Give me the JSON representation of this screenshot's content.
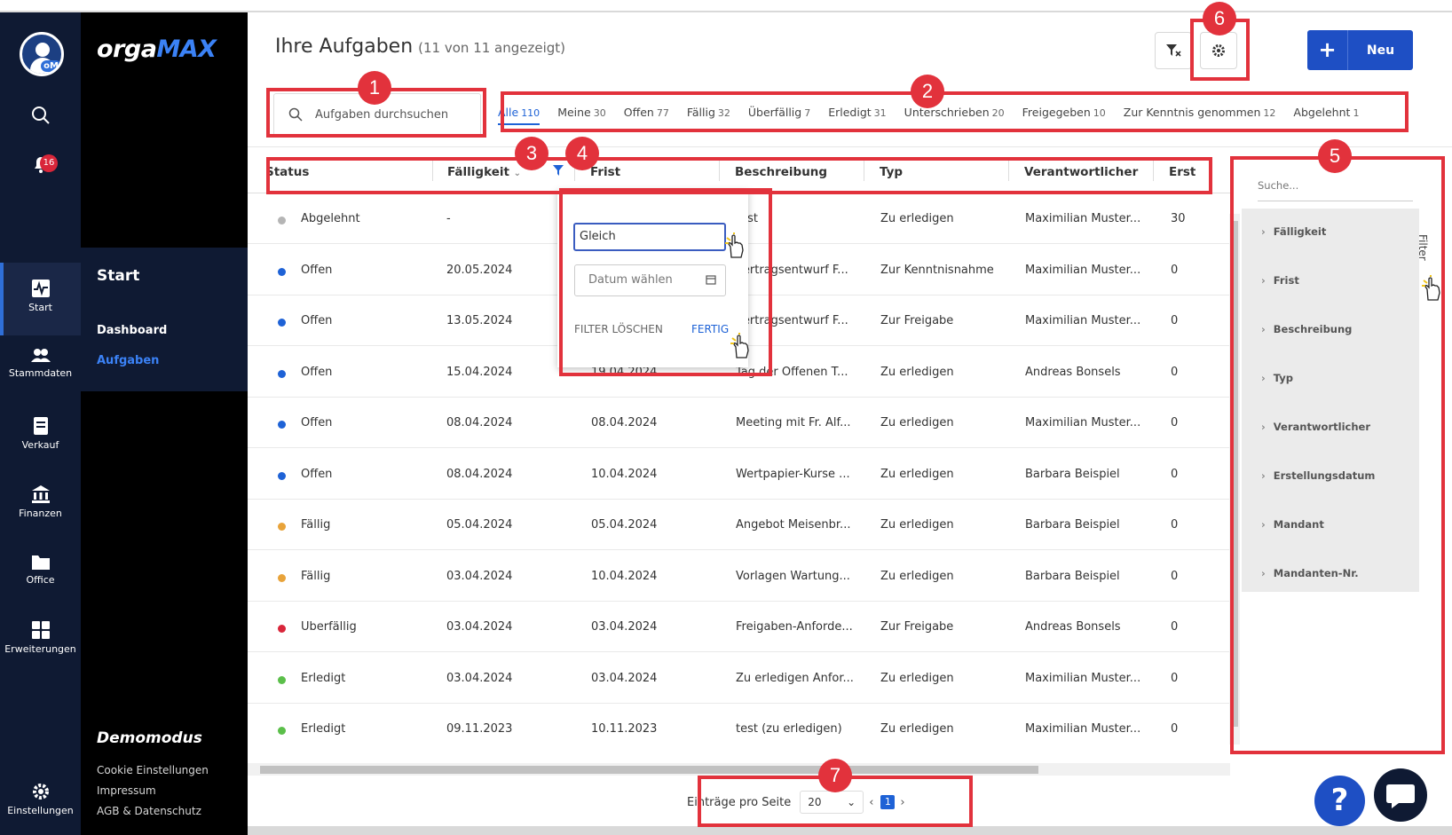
{
  "app": {
    "logo_a": "orga",
    "logo_b": "MAX"
  },
  "rail": {
    "avatar_badge": "oM",
    "notifications_count": "16",
    "items": [
      {
        "label": "Start",
        "icon": "pulse-icon"
      },
      {
        "label": "Stammdaten",
        "icon": "people-icon"
      },
      {
        "label": "Verkauf",
        "icon": "invoice-icon"
      },
      {
        "label": "Finanzen",
        "icon": "bank-icon"
      },
      {
        "label": "Office",
        "icon": "folder-icon"
      },
      {
        "label": "Erweiterungen",
        "icon": "grid-icon"
      },
      {
        "label": "Einstellungen",
        "icon": "gear-icon"
      }
    ]
  },
  "sidebar": {
    "section_title": "Start",
    "items": [
      "Dashboard",
      "Aufgaben"
    ],
    "mode": "Demomodus",
    "links": [
      "Cookie Einstellungen",
      "Impressum",
      "AGB & Datenschutz"
    ]
  },
  "header": {
    "title": "Ihre Aufgaben",
    "subtitle": "(11 von 11 angezeigt)",
    "new_label": "Neu"
  },
  "search": {
    "placeholder": "Aufgaben durchsuchen"
  },
  "tabs": [
    {
      "label": "Alle",
      "count": "110"
    },
    {
      "label": "Meine",
      "count": "30"
    },
    {
      "label": "Offen",
      "count": "77"
    },
    {
      "label": "Fällig",
      "count": "32"
    },
    {
      "label": "Überfällig",
      "count": "7"
    },
    {
      "label": "Erledigt",
      "count": "31"
    },
    {
      "label": "Unterschrieben",
      "count": "20"
    },
    {
      "label": "Freigegeben",
      "count": "10"
    },
    {
      "label": "Zur Kenntnis genommen",
      "count": "12"
    },
    {
      "label": "Abgelehnt",
      "count": "1"
    }
  ],
  "columns": [
    "Status",
    "Fälligkeit",
    "Frist",
    "Beschreibung",
    "Typ",
    "Verantwortlicher",
    "Erst"
  ],
  "status_colors": {
    "Abgelehnt": "#b5b5b5",
    "Offen": "#1e62d6",
    "Fällig": "#e8a33a",
    "Überfällig": "#d9263a",
    "Erledigt": "#5bbf4a"
  },
  "rows": [
    {
      "status": "Abgelehnt",
      "faellig": "-",
      "frist": "",
      "beschreibung": "test",
      "typ": "Zu erledigen",
      "verantwortlich": "Maximilian Muster...",
      "erst": "30"
    },
    {
      "status": "Offen",
      "faellig": "20.05.2024",
      "frist": "",
      "beschreibung": "Vertragsentwurf F...",
      "typ": "Zur Kenntnisnahme",
      "verantwortlich": "Maximilian Muster...",
      "erst": "0"
    },
    {
      "status": "Offen",
      "faellig": "13.05.2024",
      "frist": "",
      "beschreibung": "Vertragsentwurf F...",
      "typ": "Zur Freigabe",
      "verantwortlich": "Maximilian Muster...",
      "erst": "0"
    },
    {
      "status": "Offen",
      "faellig": "15.04.2024",
      "frist": "19.04.2024",
      "beschreibung": "Tag der Offenen T...",
      "typ": "Zu erledigen",
      "verantwortlich": "Andreas Bonsels",
      "erst": "0"
    },
    {
      "status": "Offen",
      "faellig": "08.04.2024",
      "frist": "08.04.2024",
      "beschreibung": "Meeting mit Fr. Alf...",
      "typ": "Zu erledigen",
      "verantwortlich": "Maximilian Muster...",
      "erst": "0"
    },
    {
      "status": "Offen",
      "faellig": "08.04.2024",
      "frist": "10.04.2024",
      "beschreibung": "Wertpapier-Kurse ...",
      "typ": "Zu erledigen",
      "verantwortlich": "Barbara Beispiel",
      "erst": "0"
    },
    {
      "status": "Fällig",
      "faellig": "05.04.2024",
      "frist": "05.04.2024",
      "beschreibung": "Angebot Meisenbr...",
      "typ": "Zu erledigen",
      "verantwortlich": "Barbara Beispiel",
      "erst": "0"
    },
    {
      "status": "Fällig",
      "faellig": "03.04.2024",
      "frist": "10.04.2024",
      "beschreibung": "Vorlagen Wartung...",
      "typ": "Zu erledigen",
      "verantwortlich": "Barbara Beispiel",
      "erst": "0"
    },
    {
      "status": "Überfällig",
      "faellig": "03.04.2024",
      "frist": "03.04.2024",
      "beschreibung": "Freigaben-Anforde...",
      "typ": "Zur Freigabe",
      "verantwortlich": "Andreas Bonsels",
      "erst": "0"
    },
    {
      "status": "Erledigt",
      "faellig": "03.04.2024",
      "frist": "03.04.2024",
      "beschreibung": "Zu erledigen Anfor...",
      "typ": "Zu erledigen",
      "verantwortlich": "Maximilian Muster...",
      "erst": "0"
    },
    {
      "status": "Erledigt",
      "faellig": "09.11.2023",
      "frist": "10.11.2023",
      "beschreibung": "test (zu erledigen)",
      "typ": "Zu erledigen",
      "verantwortlich": "Maximilian Muster...",
      "erst": "0"
    }
  ],
  "filter_popup": {
    "operator": "Gleich",
    "date_placeholder": "Datum wählen",
    "clear_label": "FILTER LÖSCHEN",
    "done_label": "FERTIG"
  },
  "filter_panel": {
    "search_placeholder": "Suche...",
    "tab_label": "Filter",
    "items": [
      "Fälligkeit",
      "Frist",
      "Beschreibung",
      "Typ",
      "Verantwortlicher",
      "Erstellungsdatum",
      "Mandant",
      "Mandanten-Nr."
    ]
  },
  "paging": {
    "label": "Einträge pro Seite",
    "page_size": "20",
    "current_page": "1"
  },
  "help_label": "?",
  "annotations": [
    "1",
    "2",
    "3",
    "4",
    "5",
    "6",
    "7"
  ]
}
